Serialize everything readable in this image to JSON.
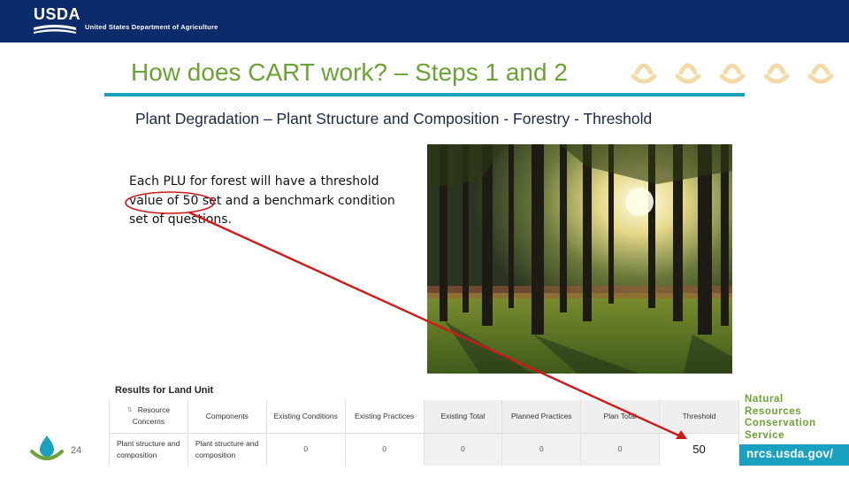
{
  "header": {
    "logo_text": "USDA",
    "department": "United States Department of Agriculture"
  },
  "slide": {
    "title": "How does CART work? – Steps 1 and 2",
    "subtitle": "Plant Degradation – Plant Structure and Composition - Forestry - Threshold",
    "body_line_1": "Each PLU for forest will have a threshold",
    "body_line_2a": "value of ",
    "body_highlight": "50",
    "body_line_2b": " set and a benchmark condition",
    "body_line_3": "set of questions.",
    "page_number": "24"
  },
  "table": {
    "title": "Results for Land Unit",
    "headers": [
      "Resource Concerns",
      "Components",
      "Existing Conditions",
      "Existing Practices",
      "Existing Total",
      "Planned Practices",
      "Plan Total",
      "Threshold"
    ],
    "row": [
      "Plant structure and composition",
      "Plant structure and composition",
      "0",
      "0",
      "0",
      "0",
      "0",
      "50"
    ]
  },
  "footer": {
    "agency_line_1": "Natural",
    "agency_line_2": "Resources",
    "agency_line_3": "Conservation",
    "agency_line_4": "Service",
    "url": "nrcs.usda.gov/"
  },
  "colors": {
    "header_bg": "#0b2b6b",
    "title_green": "#6aa333",
    "accent_teal": "#1aa1c0",
    "annotation_red": "#d01818"
  }
}
